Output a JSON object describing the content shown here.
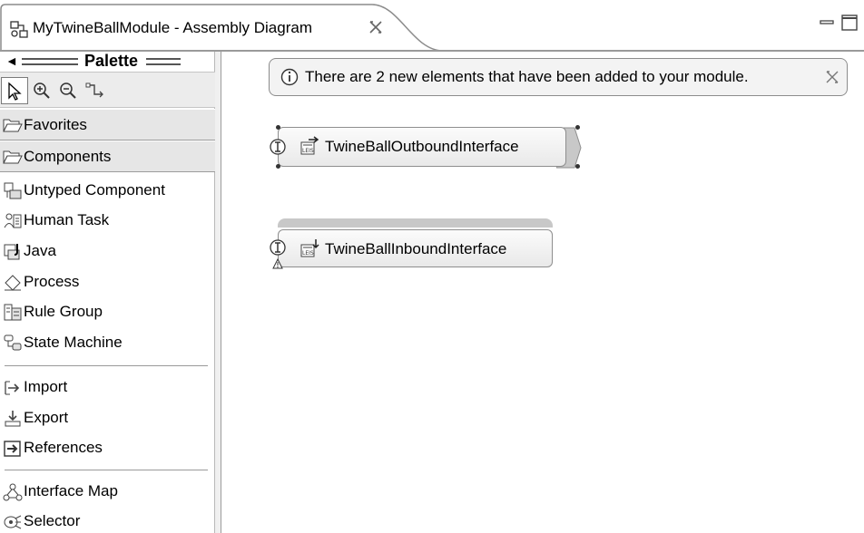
{
  "editor": {
    "tab_title": "MyTwineBallModule - Assembly Diagram"
  },
  "palette": {
    "title": "Palette",
    "tools": [
      {
        "name": "select-tool",
        "icon": "pointer-arrow-icon",
        "selected": true
      },
      {
        "name": "zoom-in-tool",
        "icon": "zoom-in-icon"
      },
      {
        "name": "zoom-out-tool",
        "icon": "zoom-out-icon"
      },
      {
        "name": "wire-tool",
        "icon": "wire-icon"
      }
    ],
    "drawers": [
      {
        "label": "Favorites",
        "icon": "folder-open-icon"
      },
      {
        "label": "Components",
        "icon": "folder-open-icon"
      }
    ],
    "components": [
      {
        "label": "Untyped Component",
        "icon": "untyped-component-icon"
      },
      {
        "label": "Human Task",
        "icon": "human-task-icon"
      },
      {
        "label": "Java",
        "icon": "java-icon"
      },
      {
        "label": "Process",
        "icon": "process-icon"
      },
      {
        "label": "Rule Group",
        "icon": "rule-group-icon"
      },
      {
        "label": "State Machine",
        "icon": "state-machine-icon"
      }
    ],
    "bindings": [
      {
        "label": "Import",
        "icon": "import-icon"
      },
      {
        "label": "Export",
        "icon": "export-icon"
      },
      {
        "label": "References",
        "icon": "references-icon"
      }
    ],
    "mediation": [
      {
        "label": "Interface Map",
        "icon": "interface-map-icon"
      },
      {
        "label": "Selector",
        "icon": "selector-icon"
      }
    ]
  },
  "canvas": {
    "notification": {
      "message": "There are 2 new elements that have been added to your module."
    },
    "nodes": [
      {
        "label": "TwineBallOutboundInterface",
        "selected": true,
        "icon": "leis-outbound-icon"
      },
      {
        "label": "TwineBallInboundInterface",
        "selected": false,
        "warning": true,
        "icon": "leis-inbound-icon"
      }
    ]
  },
  "colors": {
    "palette_drawer": "#e6e6e6",
    "node_fill": "#efefef",
    "border": "#8e8e8e"
  }
}
